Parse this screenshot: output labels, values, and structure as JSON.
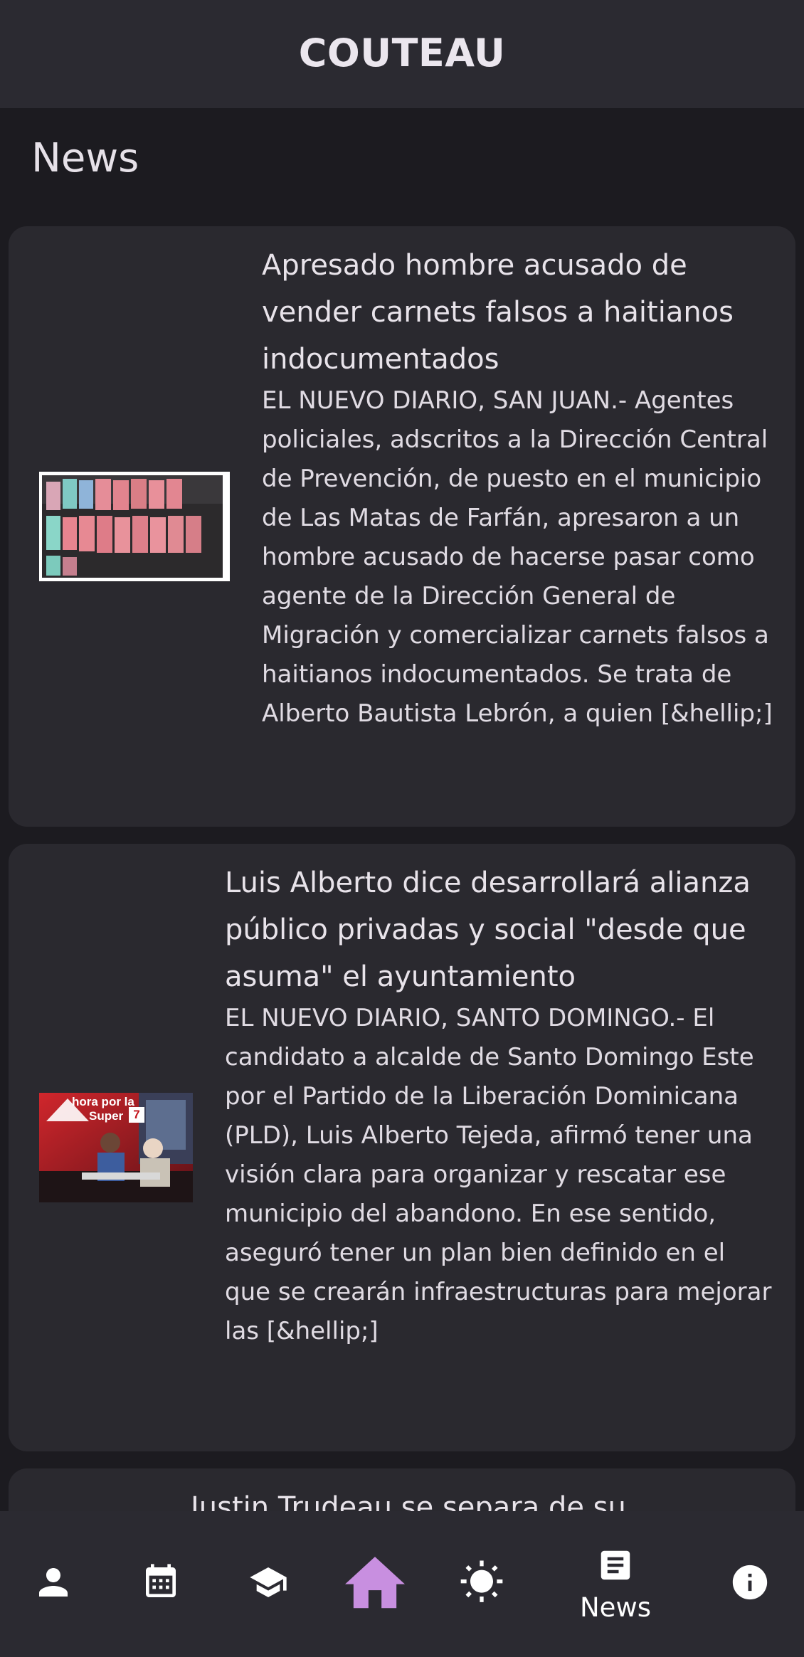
{
  "app_bar": {
    "title": "COUTEAU"
  },
  "section": {
    "title": "News"
  },
  "articles": [
    {
      "title": "Apresado hombre acusado de vender carnets falsos a haitianos indocumentados",
      "summary": "EL NUEVO DIARIO, SAN JUAN.- Agentes policiales, adscritos a la Dirección Central de Prevención, de puesto en el municipio de Las Matas de Farfán, apresaron a un hombre acusado de hacerse pasar como agente de la Dirección General de Migración y comercializar carnets falsos a haitianos indocumentados. Se trata de Alberto Bautista Lebrón, a quien [&hellip;]"
    },
    {
      "title": "Luis Alberto dice desarrollará alianza público privadas y social \"desde que asuma\" el ayuntamiento",
      "summary": "EL NUEVO DIARIO, SANTO DOMINGO.- El candidato a alcalde de Santo Domingo Este por el Partido de la Liberación Dominicana (PLD), Luis Alberto Tejeda, afirmó tener una visión clara para organizar y rescatar ese municipio del abandono. En ese sentido, aseguró tener un plan bien definido en el que se crearán infraestructuras para mejorar las [&hellip;]",
      "thumbnail_text": {
        "line1": "hora por la",
        "line2": "Super",
        "badge": "7"
      }
    },
    {
      "title": "Justin Trudeau se separa de su"
    }
  ],
  "bottom_nav": {
    "items": [
      {
        "icon": "person-icon"
      },
      {
        "icon": "calendar-icon"
      },
      {
        "icon": "school-icon"
      },
      {
        "icon": "home-icon",
        "color": "#c88fe0"
      },
      {
        "icon": "brightness-icon"
      },
      {
        "icon": "article-icon",
        "label": "News"
      },
      {
        "icon": "info-icon"
      }
    ]
  },
  "colors": {
    "background": "#1c1b20",
    "surface": "#2a292f",
    "bar": "#2b2a31",
    "accent": "#c88fe0"
  }
}
